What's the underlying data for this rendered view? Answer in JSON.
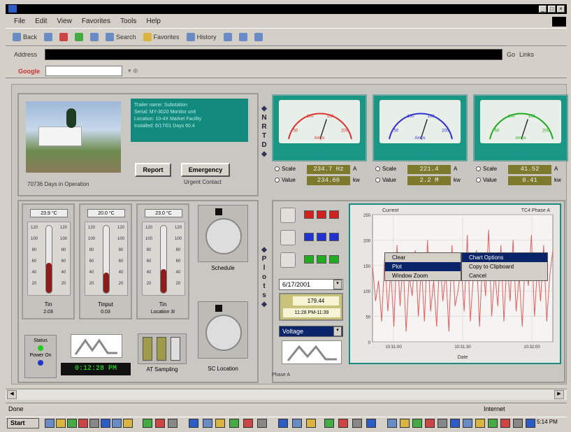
{
  "menu": [
    "File",
    "Edit",
    "View",
    "Favorites",
    "Tools",
    "Help"
  ],
  "toolbar": {
    "back": "Back",
    "search": "Search",
    "favorites": "Favorites",
    "history": "History"
  },
  "address": {
    "label": "Address",
    "go": "Go",
    "links": "Links"
  },
  "google": {
    "label": "Google"
  },
  "info_panel": {
    "lines": [
      "Trailer name: Substation",
      "Serial: MY-3020 Monitor unit",
      "Location: 10-4X Market Facility",
      "Installed: 6/17/01 Days 60.4"
    ],
    "days_label": "70736 Days in Operation"
  },
  "buttons": {
    "report": "Report",
    "emergency": "Emergency",
    "urgent_contact": "Urgent Contact"
  },
  "nav_vertical": {
    "top": "NRTD",
    "bottom": "Plots"
  },
  "meters": [
    {
      "mode1": "Scale",
      "mode2": "Value",
      "val1": "234.7 Hz",
      "val2": "234.66",
      "unit1": "A",
      "unit2": "kw",
      "label": "Amps",
      "ticks": [
        "50",
        "100",
        "150",
        "200"
      ],
      "color": "#d33"
    },
    {
      "mode1": "Scale",
      "mode2": "Value",
      "val1": "221.4",
      "val2": "2.2 M",
      "unit1": "A",
      "unit2": "kw",
      "label": "Amps",
      "ticks": [
        "50",
        "100",
        "150",
        "200"
      ],
      "color": "#33c"
    },
    {
      "mode1": "Scale",
      "mode2": "Value",
      "val1": "41.52",
      "val2": "0.41",
      "unit1": "A",
      "unit2": "kw",
      "label": "Amps",
      "ticks": [
        "50",
        "100",
        "150",
        "200"
      ],
      "color": "#2a2"
    }
  ],
  "thermometers": [
    {
      "value": "23.9",
      "unit": "°C",
      "label": "Tin",
      "sub": "2.03",
      "level": 0.45,
      "scale": [
        "120",
        "100",
        "80",
        "60",
        "40",
        "20"
      ]
    },
    {
      "value": "20.0",
      "unit": "°C",
      "label": "Tinput",
      "sub": "0.03",
      "level": 0.3,
      "scale": [
        "120",
        "100",
        "80",
        "60",
        "40",
        "20"
      ]
    },
    {
      "value": "23.0",
      "unit": "°C",
      "label": "Tin",
      "sub": "Location 3I",
      "level": 0.35,
      "scale": [
        "120",
        "100",
        "80",
        "60",
        "40",
        "20"
      ]
    }
  ],
  "dials": [
    {
      "label": "Schedule"
    },
    {
      "label": "SC Location"
    }
  ],
  "status": {
    "status_label": "Status",
    "power_label": "Power On",
    "clock": "0:12:28 PM",
    "sampling_label": "AT Sampling"
  },
  "plot_controls": {
    "date": "6/17/2001",
    "value": "179.44",
    "range": "11:28 PM-11:39",
    "select": "Voltage"
  },
  "chart_data": {
    "type": "line",
    "title": "Current",
    "legend_right": "TC4 Phase A",
    "xlabel": "Date",
    "x_ticks": [
      "10:31:00",
      "10:31:30",
      "10:32:00"
    ],
    "y_ticks": [
      "250",
      "200",
      "150",
      "100",
      "50",
      "0"
    ],
    "ylim": [
      0,
      250
    ],
    "color": "#e06060",
    "values": [
      150,
      80,
      120,
      40,
      170,
      60,
      140,
      30,
      190,
      70,
      160,
      20,
      130,
      90,
      180,
      50,
      150,
      40,
      200,
      60,
      120,
      30,
      170,
      80,
      140,
      20,
      190,
      70,
      100,
      150,
      60,
      210,
      40,
      130,
      180,
      30,
      160,
      90,
      220,
      50,
      140,
      70,
      190,
      40,
      160,
      80,
      200,
      60,
      130,
      30,
      170,
      110,
      210,
      50,
      150,
      80,
      190,
      40,
      130,
      180
    ]
  },
  "context_menu": {
    "items": [
      "Clear",
      "Plot",
      "Window Zoom"
    ],
    "sub_items": [
      "Chart Options",
      "Copy to Clipboard",
      "Cancel"
    ]
  },
  "status_bar": {
    "left": "Done",
    "right": "Internet"
  },
  "taskbar": {
    "start": "Start",
    "time": "5:14 PM"
  }
}
